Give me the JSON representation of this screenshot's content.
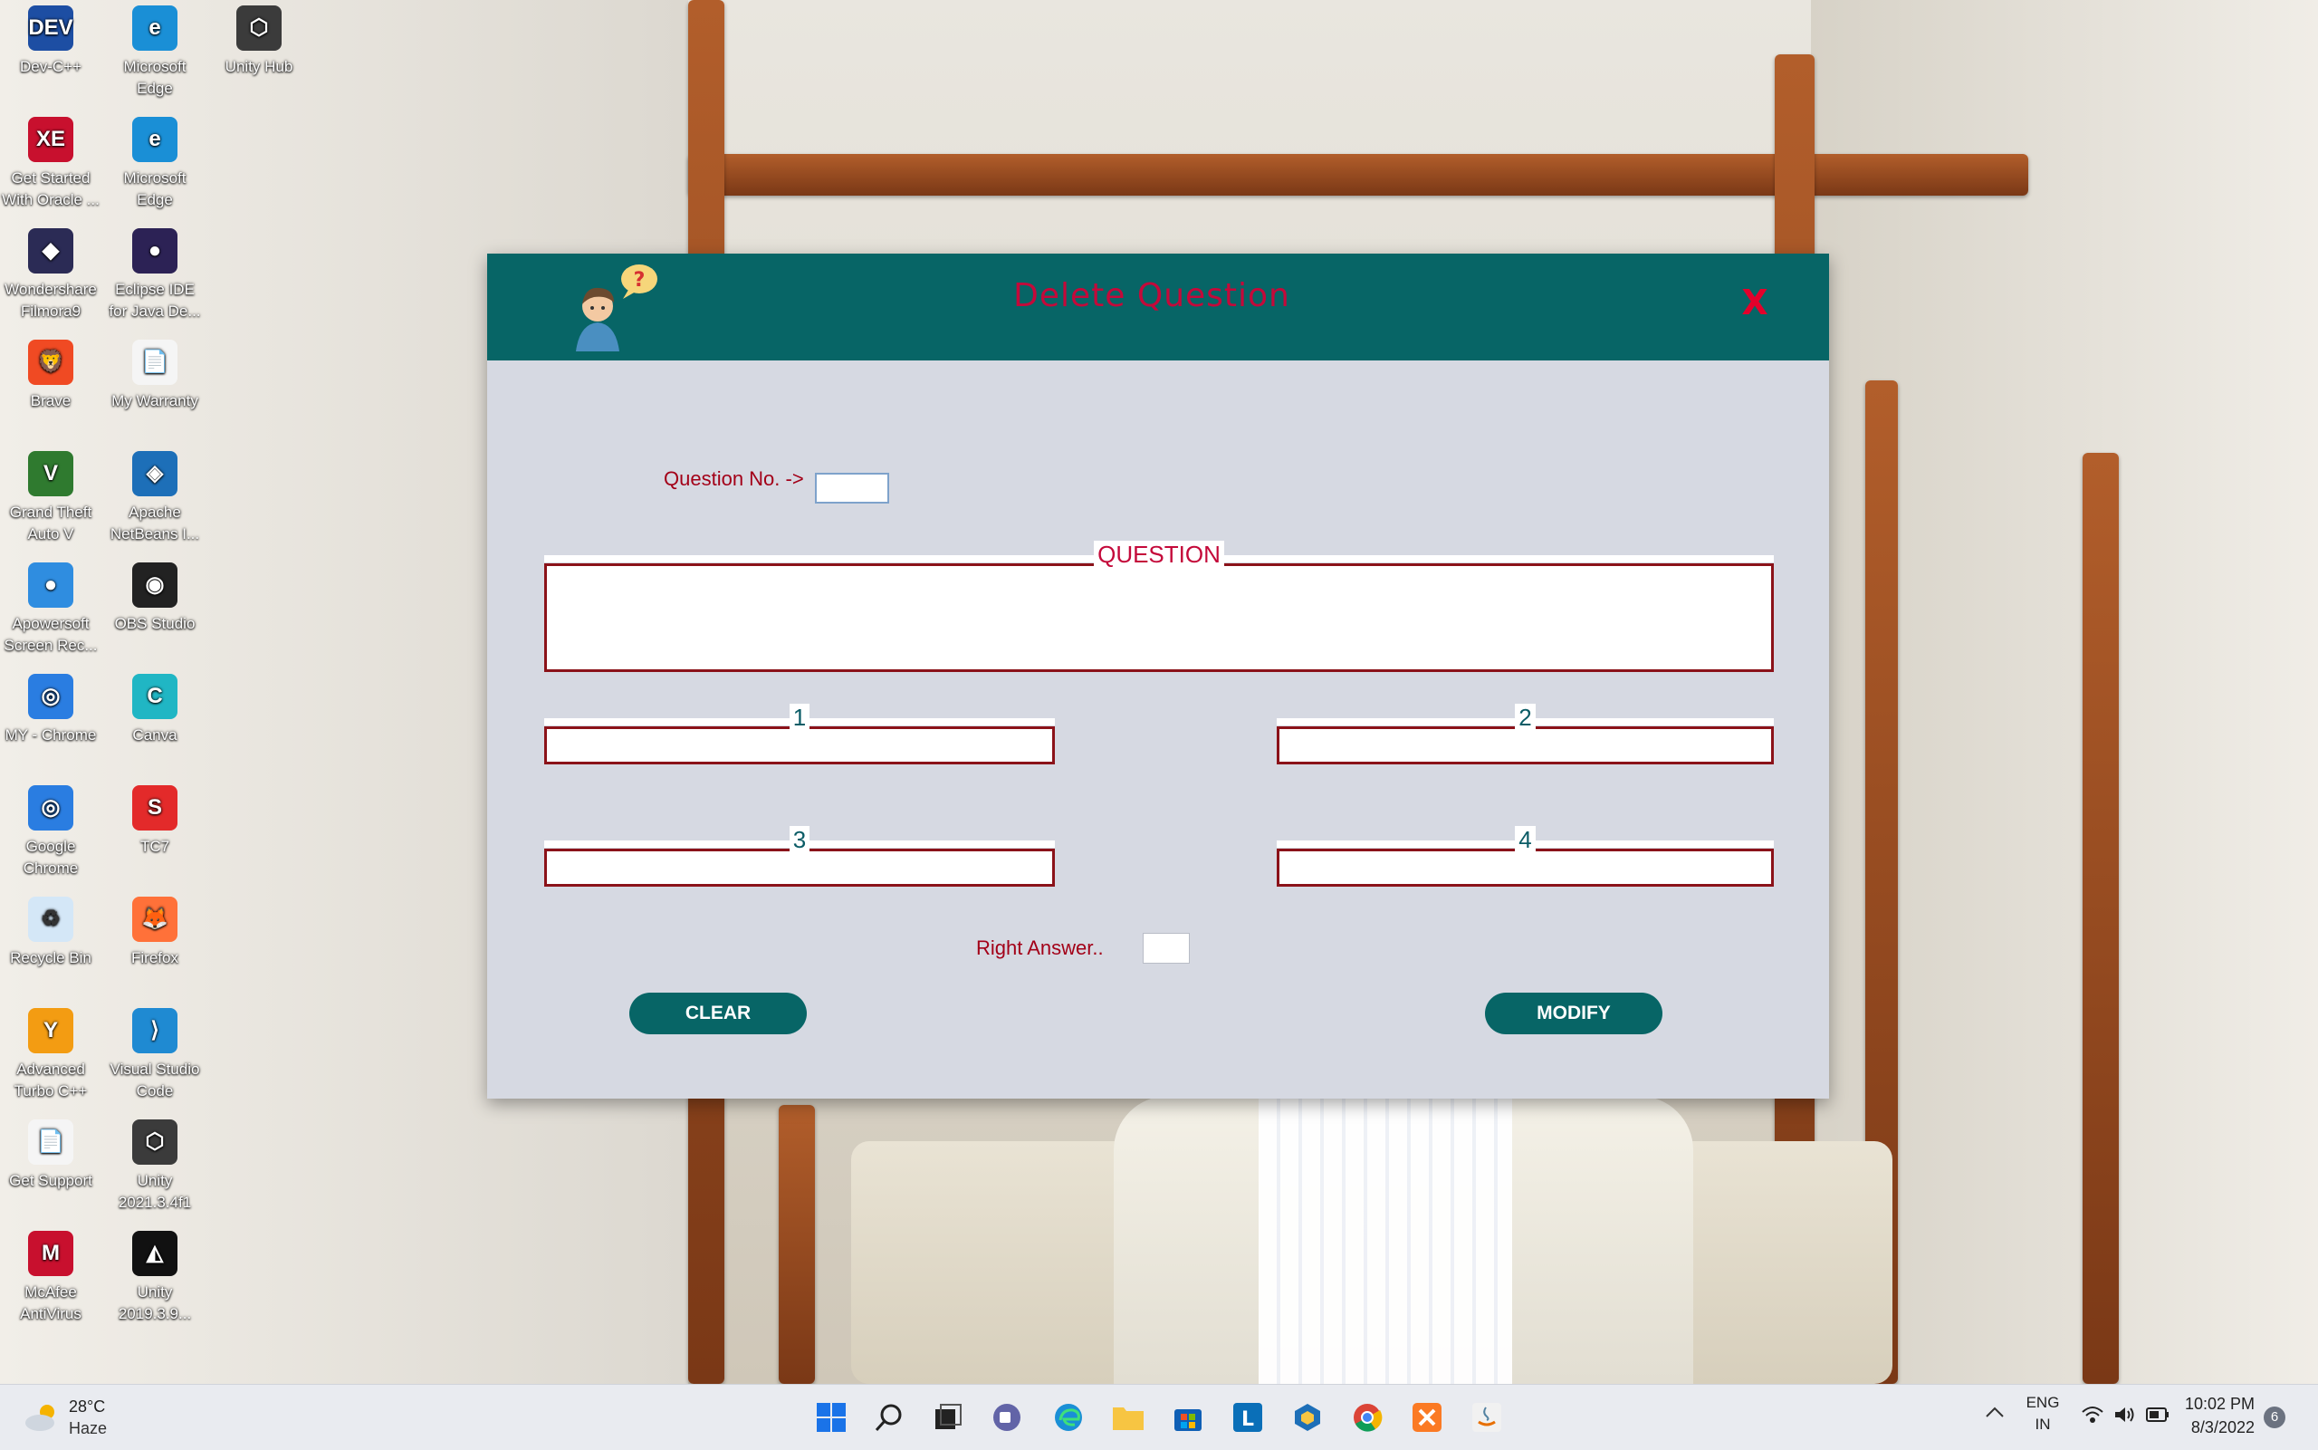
{
  "desktop": {
    "icons": [
      {
        "label": "Dev-C++",
        "icon": "devcpp-icon",
        "color": "#1d4ea3",
        "glyph": "DEV"
      },
      {
        "label": "Microsoft Edge",
        "icon": "edge-icon",
        "color": "#1a8fd6",
        "glyph": "e"
      },
      {
        "label": "Unity Hub",
        "icon": "unity-hub-icon",
        "color": "#3b3b3b",
        "glyph": "⬡"
      },
      {
        "label": "Get Started With Oracle ...",
        "icon": "oracle-icon",
        "color": "#c8102e",
        "glyph": "XE"
      },
      {
        "label": "Microsoft Edge",
        "icon": "edge-icon",
        "color": "#1a8fd6",
        "glyph": "e"
      },
      {
        "label": "Wondershare Filmora9",
        "icon": "filmora-icon",
        "color": "#2b2b55",
        "glyph": "◆"
      },
      {
        "label": "Eclipse IDE for Java De...",
        "icon": "eclipse-icon",
        "color": "#2c2255",
        "glyph": "●"
      },
      {
        "label": "Brave",
        "icon": "brave-icon",
        "color": "#f04a23",
        "glyph": "🦁"
      },
      {
        "label": "My Warranty",
        "icon": "document-icon",
        "color": "#f5f5f5",
        "glyph": "📄"
      },
      {
        "label": "Grand Theft Auto V",
        "icon": "gta-icon",
        "color": "#2f7a2f",
        "glyph": "V"
      },
      {
        "label": "Apache NetBeans I...",
        "icon": "netbeans-icon",
        "color": "#1d6fb8",
        "glyph": "◈"
      },
      {
        "label": "Apowersoft Screen Rec...",
        "icon": "apowersoft-icon",
        "color": "#2f8de0",
        "glyph": "●"
      },
      {
        "label": "OBS Studio",
        "icon": "obs-icon",
        "color": "#222",
        "glyph": "◉"
      },
      {
        "label": "MY - Chrome",
        "icon": "chrome-icon",
        "color": "#2a7de1",
        "glyph": "◎"
      },
      {
        "label": "Canva",
        "icon": "canva-icon",
        "color": "#20b6c4",
        "glyph": "C"
      },
      {
        "label": "Google Chrome",
        "icon": "chrome-icon",
        "color": "#2a7de1",
        "glyph": "◎"
      },
      {
        "label": "TC7",
        "icon": "tc7-icon",
        "color": "#e32a2a",
        "glyph": "S"
      },
      {
        "label": "Recycle Bin",
        "icon": "recycle-bin-icon",
        "color": "#d4e7f7",
        "glyph": "♻"
      },
      {
        "label": "Firefox",
        "icon": "firefox-icon",
        "color": "#ff7139",
        "glyph": "🦊"
      },
      {
        "label": "Advanced Turbo C++",
        "icon": "turbo-cpp-icon",
        "color": "#f39c12",
        "glyph": "Y"
      },
      {
        "label": "Visual Studio Code",
        "icon": "vscode-icon",
        "color": "#1f8ad2",
        "glyph": "⟩"
      },
      {
        "label": "Get Support",
        "icon": "document-icon",
        "color": "#f5f5f5",
        "glyph": "📄"
      },
      {
        "label": "Unity 2021.3.4f1",
        "icon": "unity-icon",
        "color": "#3b3b3b",
        "glyph": "⬡"
      },
      {
        "label": "McAfee AntiVirus",
        "icon": "mcafee-icon",
        "color": "#c8102e",
        "glyph": "M"
      },
      {
        "label": "Unity 2019.3.9...",
        "icon": "unity-icon",
        "color": "#111",
        "glyph": "◭"
      }
    ]
  },
  "dialog": {
    "title": "Delete Question",
    "close_label": "X",
    "question_no_label": "Question No. ->",
    "question_no_value": "",
    "question_legend": "QUESTION",
    "question_text": "",
    "options": [
      {
        "legend": "1",
        "value": ""
      },
      {
        "legend": "2",
        "value": ""
      },
      {
        "legend": "3",
        "value": ""
      },
      {
        "legend": "4",
        "value": ""
      }
    ],
    "right_answer_label": "Right Answer..",
    "right_answer_value": "",
    "clear_label": "CLEAR",
    "modify_label": "MODIFY",
    "colors": {
      "header": "#076566",
      "title": "#c4093a",
      "body": "#d6d9e2",
      "border": "#8b1219"
    }
  },
  "taskbar": {
    "weather": {
      "temp": "28°C",
      "condition": "Haze"
    },
    "apps": [
      "start-icon",
      "search-icon",
      "task-view-icon",
      "chat-icon",
      "edge-icon",
      "file-explorer-icon",
      "store-icon",
      "l-app-icon",
      "netbeans-icon",
      "chrome-icon",
      "xampp-icon",
      "java-icon"
    ],
    "tray": {
      "language": "ENG",
      "region": "IN",
      "time": "10:02 PM",
      "date": "8/3/2022",
      "notifications": "6"
    }
  }
}
